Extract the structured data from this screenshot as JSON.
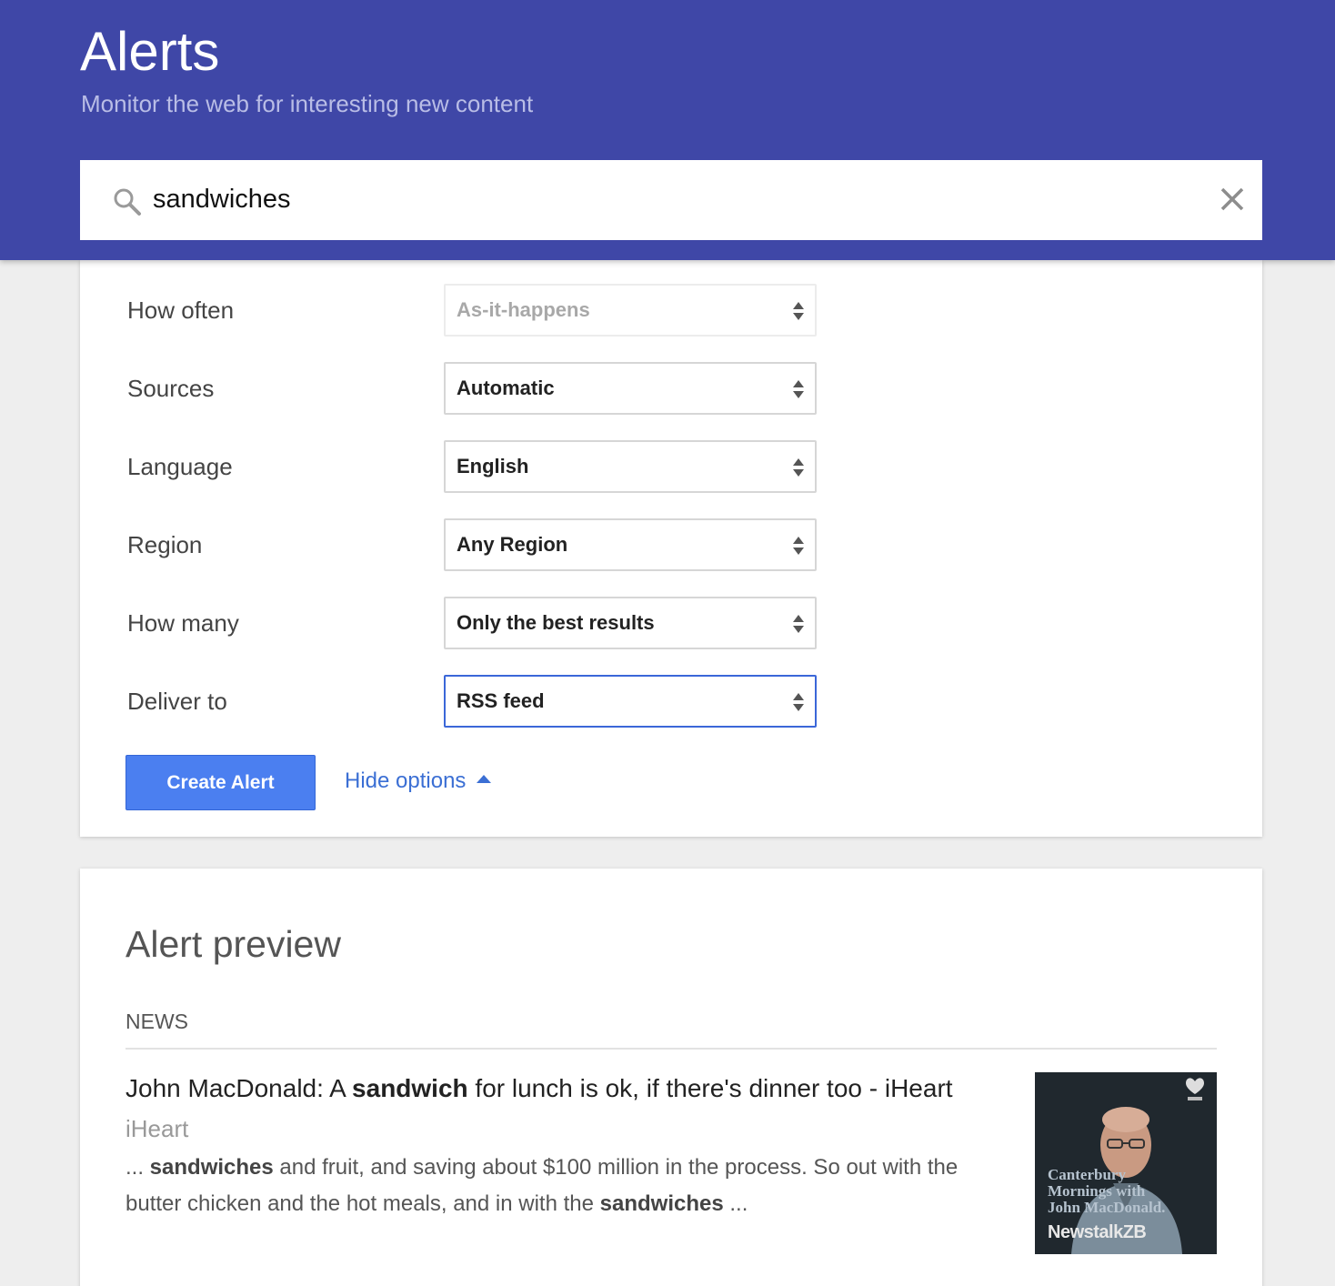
{
  "header": {
    "title": "Alerts",
    "subtitle": "Monitor the web for interesting new content"
  },
  "search": {
    "query": "sandwiches",
    "icon": "search-icon",
    "clear_icon": "close-icon"
  },
  "options": [
    {
      "label": "How often",
      "value": "As-it-happens",
      "state": "disabled"
    },
    {
      "label": "Sources",
      "value": "Automatic",
      "state": "normal"
    },
    {
      "label": "Language",
      "value": "English",
      "state": "normal"
    },
    {
      "label": "Region",
      "value": "Any Region",
      "state": "normal"
    },
    {
      "label": "How many",
      "value": "Only the best results",
      "state": "normal"
    },
    {
      "label": "Deliver to",
      "value": "RSS feed",
      "state": "focused"
    }
  ],
  "actions": {
    "create_label": "Create Alert",
    "hide_options_label": "Hide options"
  },
  "preview": {
    "title": "Alert preview",
    "section": "NEWS",
    "article": {
      "title_before": "John MacDonald: A ",
      "title_bold": "sandwich",
      "title_after": " for lunch is ok, if there's dinner too - iHeart",
      "source": "iHeart",
      "snippet_start": "... ",
      "snippet_bold_1": "sandwiches",
      "snippet_middle": " and fruit, and saving about $100 million in the process. So out with the butter chicken and the hot meals, and in with the ",
      "snippet_bold_2": "sandwiches",
      "snippet_end": " ...",
      "thumbnail": {
        "caption_line1": "Canterbury",
        "caption_line2": "Mornings with",
        "caption_line3": "John MacDonald.",
        "brand": "NewstalkZB"
      }
    }
  },
  "colors": {
    "header_bg": "#3f47a7",
    "primary_button": "#4b7ff0",
    "link": "#3b6fd4"
  }
}
